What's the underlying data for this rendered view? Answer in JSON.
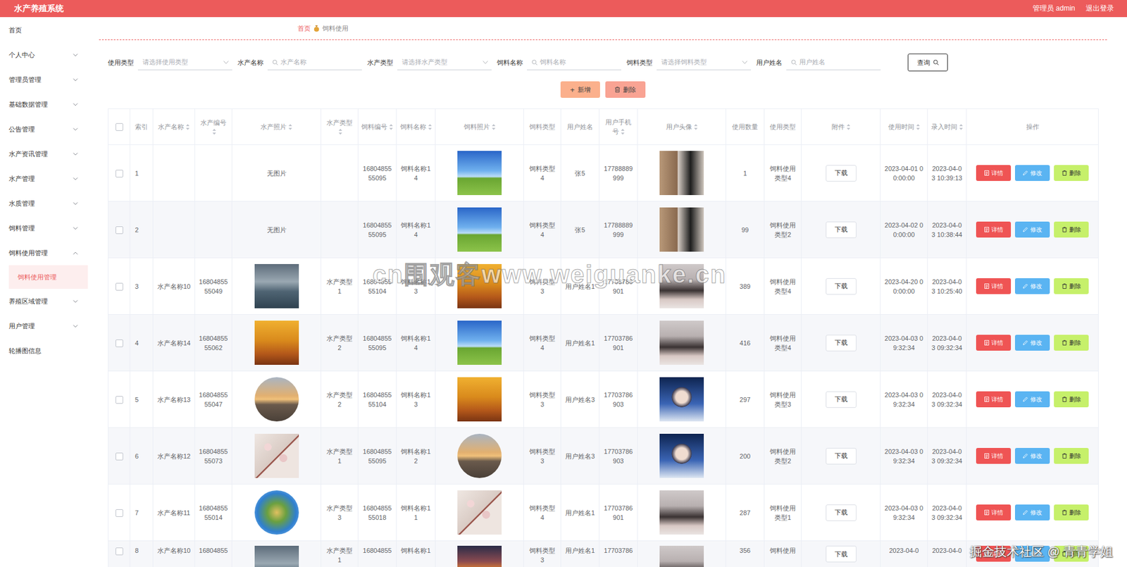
{
  "app": {
    "title": "水产养殖系统",
    "user": "管理员 admin",
    "logout": "退出登录"
  },
  "sidebar": {
    "items": [
      {
        "label": "首页",
        "expandable": false,
        "expanded": false,
        "children": []
      },
      {
        "label": "个人中心",
        "expandable": true,
        "expanded": false,
        "children": []
      },
      {
        "label": "管理员管理",
        "expandable": true,
        "expanded": false,
        "children": []
      },
      {
        "label": "基础数据管理",
        "expandable": true,
        "expanded": false,
        "children": []
      },
      {
        "label": "公告管理",
        "expandable": true,
        "expanded": false,
        "children": []
      },
      {
        "label": "水产资讯管理",
        "expandable": true,
        "expanded": false,
        "children": []
      },
      {
        "label": "水产管理",
        "expandable": true,
        "expanded": false,
        "children": []
      },
      {
        "label": "水质管理",
        "expandable": true,
        "expanded": false,
        "children": []
      },
      {
        "label": "饲料管理",
        "expandable": true,
        "expanded": false,
        "children": []
      },
      {
        "label": "饲料使用管理",
        "expandable": true,
        "expanded": true,
        "children": [
          {
            "label": "饲料使用管理",
            "selected": true
          }
        ]
      },
      {
        "label": "养殖区域管理",
        "expandable": true,
        "expanded": false,
        "children": []
      },
      {
        "label": "用户管理",
        "expandable": true,
        "expanded": false,
        "children": []
      },
      {
        "label": "轮播图信息",
        "expandable": false,
        "expanded": false,
        "children": []
      }
    ]
  },
  "breadcrumb": {
    "home": "首页",
    "current": "饲料使用"
  },
  "filters": [
    {
      "label": "使用类型",
      "placeholder": "请选择使用类型",
      "kind": "select"
    },
    {
      "label": "水产名称",
      "placeholder": "水产名称",
      "kind": "search"
    },
    {
      "label": "水产类型",
      "placeholder": "请选择水产类型",
      "kind": "select"
    },
    {
      "label": "饲料名称",
      "placeholder": "饲料名称",
      "kind": "search"
    },
    {
      "label": "饲料类型",
      "placeholder": "请选择饲料类型",
      "kind": "select"
    },
    {
      "label": "用户姓名",
      "placeholder": "用户姓名",
      "kind": "search"
    }
  ],
  "query_button": "查询",
  "actions": [
    {
      "label": "新增",
      "icon": "+",
      "kind": "add"
    },
    {
      "label": "删除",
      "icon": "",
      "kind": "delete"
    }
  ],
  "table": {
    "all_checked": false,
    "columns": [
      {
        "label": "索引",
        "sortable": false
      },
      {
        "label": "水产名称",
        "sortable": true
      },
      {
        "label": "水产编号",
        "sortable": true
      },
      {
        "label": "水产照片",
        "sortable": true
      },
      {
        "label": "水产类型",
        "sortable": true
      },
      {
        "label": "饲料编号",
        "sortable": true
      },
      {
        "label": "饲料名称",
        "sortable": true
      },
      {
        "label": "饲料照片",
        "sortable": true
      },
      {
        "label": "饲料类型",
        "sortable": false
      },
      {
        "label": "用户姓名",
        "sortable": false
      },
      {
        "label": "用户手机号",
        "sortable": true
      },
      {
        "label": "用户头像",
        "sortable": true
      },
      {
        "label": "使用数量",
        "sortable": false
      },
      {
        "label": "使用类型",
        "sortable": false
      },
      {
        "label": "附件",
        "sortable": true
      },
      {
        "label": "使用时间",
        "sortable": true
      },
      {
        "label": "录入时间",
        "sortable": true
      },
      {
        "label": "操作",
        "sortable": false
      }
    ],
    "row_actions": [
      {
        "label": "详情",
        "kind": "detail"
      },
      {
        "label": "修改",
        "kind": "edit"
      },
      {
        "label": "删除",
        "kind": "delete"
      }
    ],
    "rows": [
      {
        "index": "1",
        "name": "",
        "code": "",
        "photo": {
          "kind": "none",
          "text": "无图片"
        },
        "type": "",
        "feed_code": "1680485555095",
        "feed_name": "饲料名称14",
        "feed_photo": {
          "kind": "sky"
        },
        "feed_type": "饲料类型4",
        "user": "张5",
        "phone": "17788889999",
        "avatar": {
          "kind": "man"
        },
        "quantity": "1",
        "use_type": "饲料使用类型4",
        "attachment": "下载",
        "use_time": "2023-04-01 00:00:00",
        "created": "2023-04-03 10:39:13",
        "selected": false
      },
      {
        "index": "2",
        "name": "",
        "code": "",
        "photo": {
          "kind": "none",
          "text": "无图片"
        },
        "type": "",
        "feed_code": "1680485555095",
        "feed_name": "饲料名称14",
        "feed_photo": {
          "kind": "sky"
        },
        "feed_type": "饲料类型4",
        "user": "张5",
        "phone": "17788889999",
        "avatar": {
          "kind": "man"
        },
        "quantity": "99",
        "use_type": "饲料使用类型2",
        "attachment": "下载",
        "use_time": "2023-04-02 00:00:00",
        "created": "2023-04-03 10:38:44",
        "selected": false
      },
      {
        "index": "3",
        "name": "水产名称10",
        "code": "1680485555049",
        "photo": {
          "kind": "lake",
          "text": ""
        },
        "type": "水产类型1",
        "feed_code": "1680485555104",
        "feed_name": "饲料名称13",
        "feed_photo": {
          "kind": "autumn"
        },
        "feed_type": "饲料类型3",
        "user": "用户姓名1",
        "phone": "17703786901",
        "avatar": {
          "kind": "woman"
        },
        "quantity": "389",
        "use_type": "饲料使用类型4",
        "attachment": "下载",
        "use_time": "2023-04-20 00:00:00",
        "created": "2023-04-03 10:25:40",
        "selected": false
      },
      {
        "index": "4",
        "name": "水产名称14",
        "code": "1680485555062",
        "photo": {
          "kind": "autumn",
          "text": ""
        },
        "type": "水产类型2",
        "feed_code": "1680485555095",
        "feed_name": "饲料名称14",
        "feed_photo": {
          "kind": "sky"
        },
        "feed_type": "饲料类型4",
        "user": "用户姓名1",
        "phone": "17703786901",
        "avatar": {
          "kind": "woman"
        },
        "quantity": "416",
        "use_type": "饲料使用类型4",
        "attachment": "下载",
        "use_time": "2023-04-03 09:32:34",
        "created": "2023-04-03 09:32:34",
        "selected": false
      },
      {
        "index": "5",
        "name": "水产名称13",
        "code": "1680485555047",
        "photo": {
          "kind": "sunset",
          "text": ""
        },
        "type": "水产类型2",
        "feed_code": "1680485555104",
        "feed_name": "饲料名称13",
        "feed_photo": {
          "kind": "autumn"
        },
        "feed_type": "饲料类型3",
        "user": "用户姓名3",
        "phone": "17703786903",
        "avatar": {
          "kind": "boy"
        },
        "quantity": "297",
        "use_type": "饲料使用类型3",
        "attachment": "下载",
        "use_time": "2023-04-03 09:32:34",
        "created": "2023-04-03 09:32:34",
        "selected": false
      },
      {
        "index": "6",
        "name": "水产名称12",
        "code": "1680485555073",
        "photo": {
          "kind": "blossom",
          "text": ""
        },
        "type": "水产类型1",
        "feed_code": "1680485555095",
        "feed_name": "饲料名称12",
        "feed_photo": {
          "kind": "sunset"
        },
        "feed_type": "饲料类型3",
        "user": "用户姓名3",
        "phone": "17703786903",
        "avatar": {
          "kind": "boy"
        },
        "quantity": "200",
        "use_type": "饲料使用类型2",
        "attachment": "下载",
        "use_time": "2023-04-03 09:32:34",
        "created": "2023-04-03 09:32:34",
        "selected": false
      },
      {
        "index": "7",
        "name": "水产名称11",
        "code": "1680485555014",
        "photo": {
          "kind": "planet",
          "text": ""
        },
        "type": "水产类型3",
        "feed_code": "1680485555018",
        "feed_name": "饲料名称11",
        "feed_photo": {
          "kind": "blossom"
        },
        "feed_type": "饲料类型4",
        "user": "用户姓名1",
        "phone": "17703786901",
        "avatar": {
          "kind": "woman"
        },
        "quantity": "287",
        "use_type": "饲料使用类型1",
        "attachment": "下载",
        "use_time": "2023-04-03 09:32:34",
        "created": "2023-04-03 09:32:34",
        "selected": false
      },
      {
        "index": "8",
        "name": "水产名称10",
        "code": "16804855",
        "photo": {
          "kind": "lake",
          "text": ""
        },
        "type": "水产类型1",
        "feed_code": "16804855",
        "feed_name": "饲料名称1",
        "feed_photo": {
          "kind": "dusk"
        },
        "feed_type": "饲料类型3",
        "user": "用户姓名1",
        "phone": "17703786",
        "avatar": {
          "kind": "woman"
        },
        "quantity": "356",
        "use_type": "饲料使用",
        "attachment": "下载",
        "use_time": "2023-04-0",
        "created": "2023-04-0",
        "selected": false
      }
    ]
  },
  "watermarks": [
    "cn围观客www.weiguanke.cn",
    "掘金技术社区 @ 青青学姐"
  ]
}
